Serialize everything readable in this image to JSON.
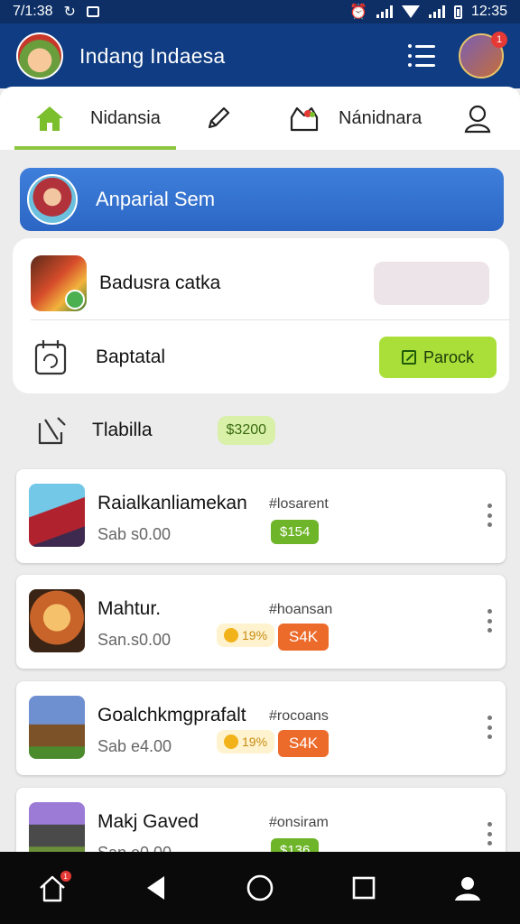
{
  "status_bar": {
    "time": "7/1:38",
    "clock": "12:35"
  },
  "app_bar": {
    "title": "Indang Indaesa",
    "notification_count": "1"
  },
  "tabs": [
    {
      "label": "Nidansia",
      "icon": "home-icon",
      "active": true
    },
    {
      "label": "",
      "icon": "pencil-icon",
      "active": false
    },
    {
      "label": "Nánidnara",
      "icon": "shop-icon",
      "active": false
    },
    {
      "label": "",
      "icon": "user-icon",
      "active": false
    }
  ],
  "banner": {
    "text": "Anparial Sem"
  },
  "panel": {
    "row1": {
      "title": "Badusra catka"
    },
    "row2": {
      "title": "Baptatal",
      "button_label": "Parock"
    }
  },
  "section": {
    "title": "Tlabilla",
    "price": "$3200"
  },
  "cards": [
    {
      "title": "Raialkanliamekan",
      "subtitle": "Sab s0.00",
      "tag": "#losarent",
      "badge": "$154",
      "badge_style": "green"
    },
    {
      "title": "Mahtur.",
      "subtitle": "San.s0.00",
      "tag": "#hoansan",
      "coin": "19%",
      "badge": "S4K",
      "badge_style": "orange"
    },
    {
      "title": "Goalchkmgprafalt",
      "subtitle": "Sab e4.00",
      "tag": "#rocoans",
      "coin": "19%",
      "badge": "S4K",
      "badge_style": "orange"
    },
    {
      "title": "Makj Gaved",
      "subtitle": "San e0.00",
      "tag": "#onsiram",
      "badge": "$136",
      "badge_style": "green"
    }
  ],
  "nav_bar": {
    "home_badge": "1"
  },
  "colors": {
    "app_bar": "#0f3c82",
    "accent_green": "#8cc63f",
    "banner_blue": "#3e7fdb",
    "orange": "#ec6a2a"
  }
}
